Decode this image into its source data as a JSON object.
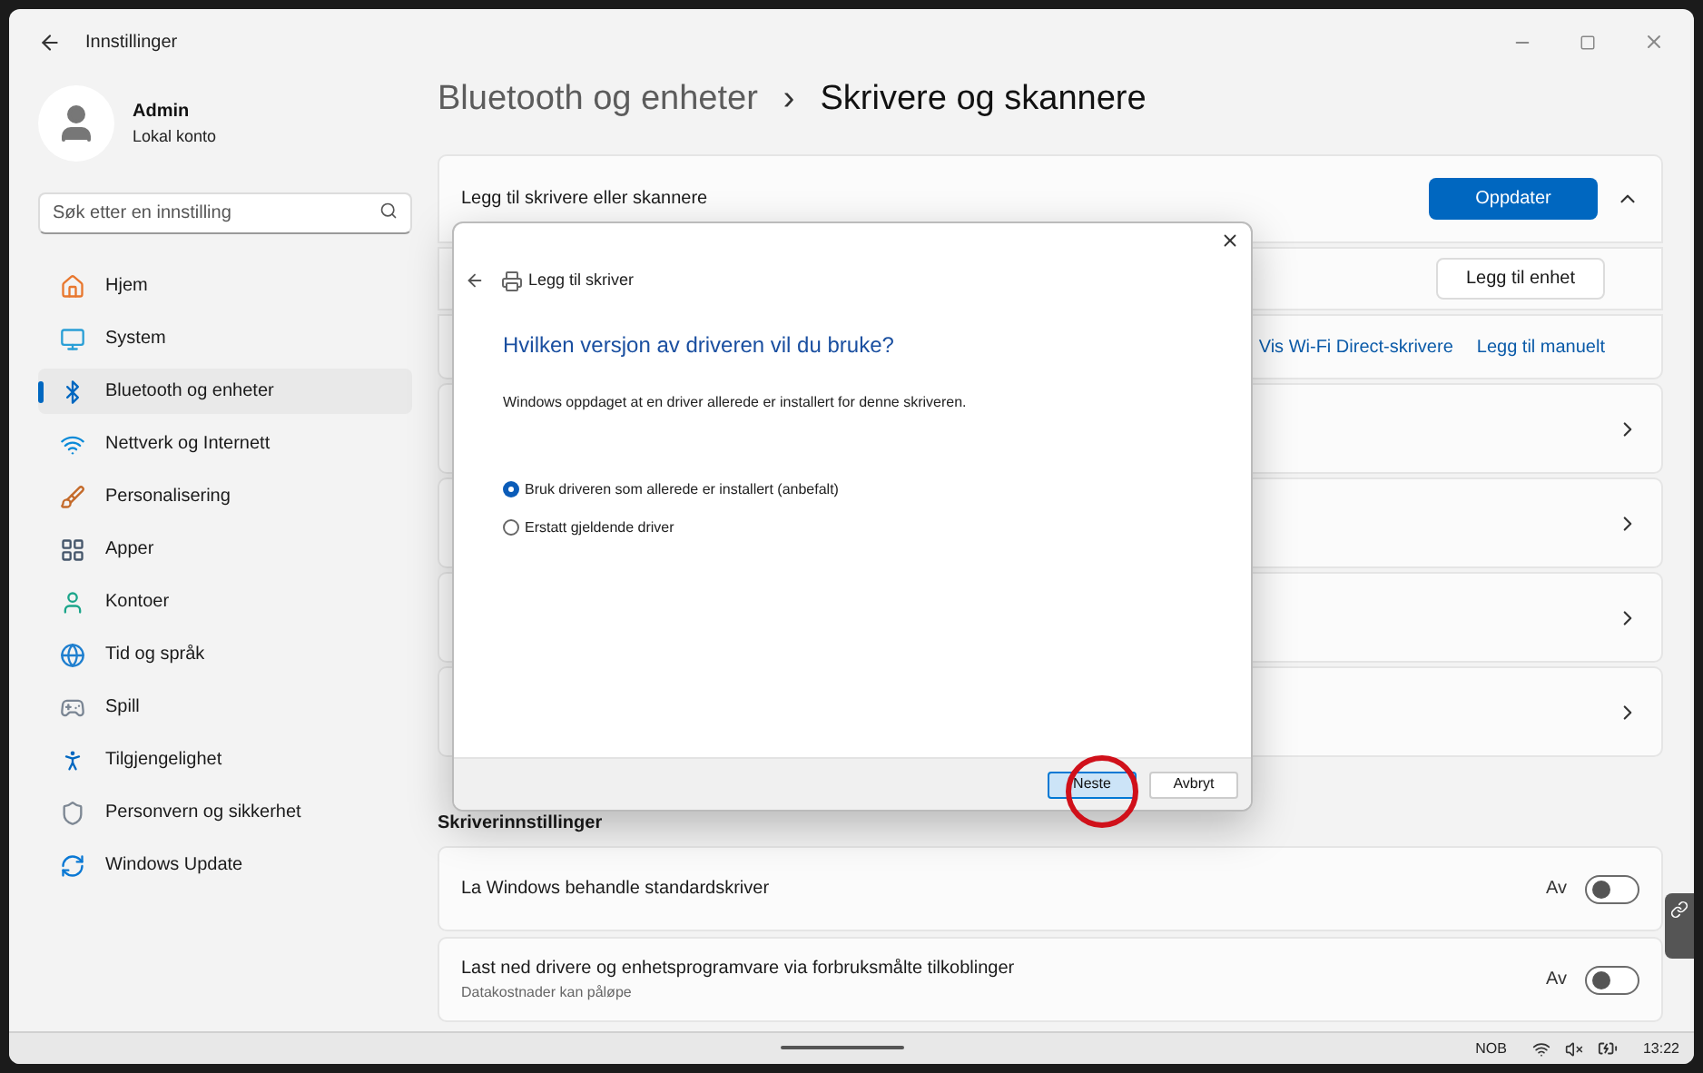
{
  "window": {
    "title": "Innstillinger"
  },
  "account": {
    "name": "Admin",
    "type": "Lokal konto"
  },
  "search": {
    "placeholder": "Søk etter en innstilling"
  },
  "nav": [
    {
      "label": "Hjem",
      "selected": false
    },
    {
      "label": "System",
      "selected": false
    },
    {
      "label": "Bluetooth og enheter",
      "selected": true
    },
    {
      "label": "Nettverk og Internett",
      "selected": false
    },
    {
      "label": "Personalisering",
      "selected": false
    },
    {
      "label": "Apper",
      "selected": false
    },
    {
      "label": "Kontoer",
      "selected": false
    },
    {
      "label": "Tid og språk",
      "selected": false
    },
    {
      "label": "Spill",
      "selected": false
    },
    {
      "label": "Tilgjengelighet",
      "selected": false
    },
    {
      "label": "Personvern og sikkerhet",
      "selected": false
    },
    {
      "label": "Windows Update",
      "selected": false
    }
  ],
  "breadcrumb": {
    "parent": "Bluetooth og enheter",
    "separator": "›",
    "current": "Skrivere og skannere"
  },
  "add_section": {
    "title": "Legg til skrivere eller skannere",
    "refresh_button": "Oppdater",
    "expanded": true,
    "add_device_button": "Legg til enhet",
    "links": [
      "Vis Wi-Fi Direct-skrivere",
      "Legg til manuelt"
    ]
  },
  "printer_settings": {
    "heading": "Skriverinnstillinger",
    "items": [
      {
        "label": "La Windows behandle standardskriver",
        "state": "Av",
        "on": false
      },
      {
        "label": "Last ned drivere og enhetsprogramvare via forbruksmålte tilkoblinger",
        "description": "Datakostnader kan påløpe",
        "state": "Av",
        "on": false
      }
    ]
  },
  "dialog": {
    "title": "Legg til skriver",
    "heading": "Hvilken versjon av driveren vil du bruke?",
    "message": "Windows oppdaget at en driver allerede er installert for denne skriveren.",
    "options": [
      {
        "label": "Bruk driveren som allerede er installert (anbefalt)",
        "selected": true
      },
      {
        "label": "Erstatt gjeldende driver",
        "selected": false
      }
    ],
    "next_button": "Neste",
    "cancel_button": "Avbryt"
  },
  "taskbar": {
    "language": "NOB",
    "time": "13:22"
  }
}
